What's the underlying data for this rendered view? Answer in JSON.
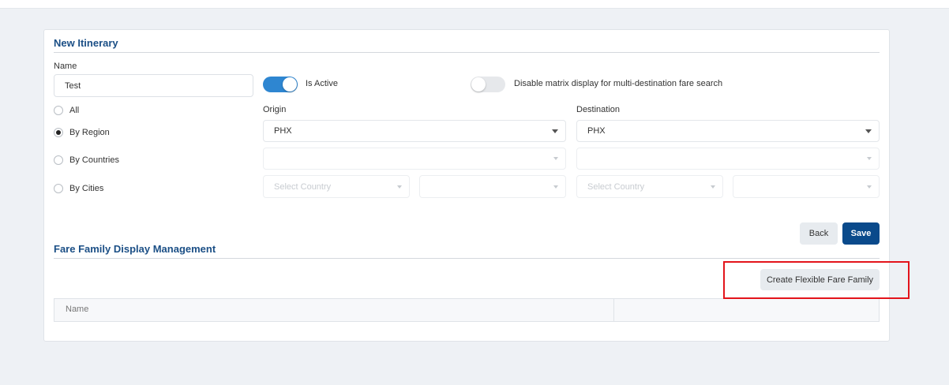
{
  "form": {
    "title": "New Itinerary",
    "name_label": "Name",
    "name_value": "Test",
    "is_active_label": "Is Active",
    "is_active": true,
    "disable_matrix_label": "Disable matrix display for multi-destination fare search",
    "disable_matrix": false,
    "scope_options": [
      {
        "label": "All",
        "checked": false
      },
      {
        "label": "By Region",
        "checked": true
      },
      {
        "label": "By Countries",
        "checked": false
      },
      {
        "label": "By Cities",
        "checked": false
      }
    ],
    "origin_label": "Origin",
    "destination_label": "Destination",
    "origin_region": "PHX",
    "destination_region": "PHX",
    "origin_country_placeholder": "Select Country",
    "destination_country_placeholder": "Select Country",
    "back_label": "Back",
    "save_label": "Save"
  },
  "fare_family": {
    "title": "Fare Family Display Management",
    "create_label": "Create Flexible Fare Family",
    "columns": [
      "Name",
      ""
    ]
  },
  "colors": {
    "accent": "#1b4f86",
    "primary_button": "#0a4a8b",
    "toggle_on": "#2e86d1",
    "highlight": "#e3141b"
  }
}
